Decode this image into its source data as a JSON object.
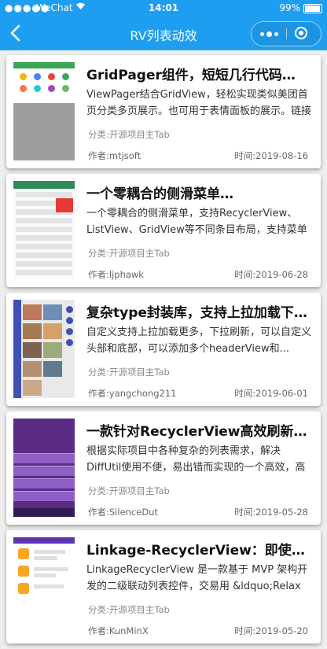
{
  "status_bar": {
    "signal": "●●●●●",
    "carrier": "WeChat",
    "wifi_icon": "wifi-icon",
    "time": "14:01",
    "battery": "99%"
  },
  "nav": {
    "title": "RV列表动效",
    "back_icon": "back-chevron-icon",
    "more_icon": "more-dots-icon",
    "close_icon": "close-target-icon",
    "accent": "#1e9ef0"
  },
  "items": [
    {
      "title": "GridPager组件，短短几行代码即实现网格分页",
      "desc": "ViewPager结合GridView，轻松实现类似美团首页分类多页展示。也可用于表情面板的展示。链接",
      "category": "分类:开源项目主Tab",
      "author": "作者:mtjsoft",
      "date": "时间:2019-08-16"
    },
    {
      "title": "一个零耦合的侧滑菜单…",
      "desc": "一个零耦合的侧滑菜单，支持RecyclerView、ListView、GridView等不同条目布局，支持菜单在左",
      "category": "分类:开源项目主Tab",
      "author": "作者:ljphawk",
      "date": "时间:2019-06-28"
    },
    {
      "title": "复杂type封装库，支持上拉加载下拉刷新",
      "desc": "自定义支持上拉加载更多，下拉刷新，可以自定义头部和底部，可以添加多个headerView和...",
      "category": "分类:开源项目主Tab",
      "author": "作者:yangchong211",
      "date": "时间:2019-06-01"
    },
    {
      "title": "一款针对RecyclerView高效刷新，多类型",
      "desc": "根据实际项目中各种复杂的列表需求，解决DiffUtil使用不便，易出错而实现的一个高效，高度",
      "category": "分类:开源项目主Tab",
      "author": "作者:SilenceDut",
      "date": "时间:2019-05-28"
    },
    {
      "title": "Linkage-RecyclerView：即使不用饿了么",
      "desc": "LinkageRecyclerView 是一款基于 MVP 架构开发的二级联动列表控件，交易用 &ldquo;Relax",
      "category": "分类:开源项目主Tab",
      "author": "作者:KunMinX",
      "date": "时间:2019-05-20"
    }
  ]
}
